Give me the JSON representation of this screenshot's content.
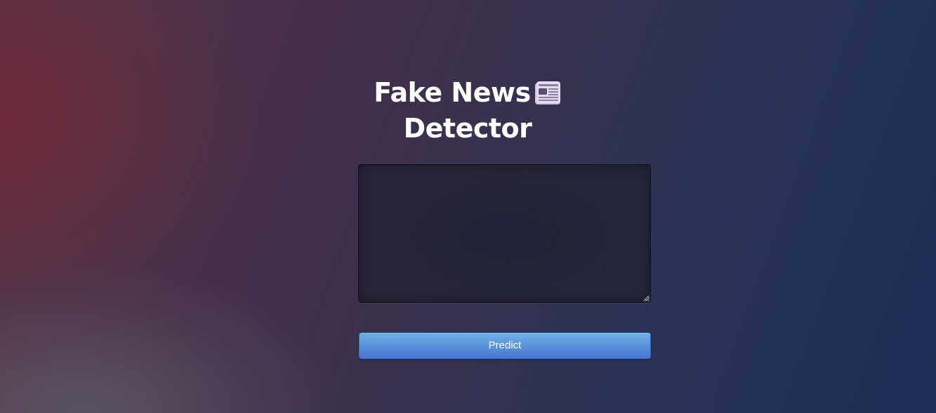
{
  "header": {
    "title_line1": "Fake News",
    "title_line2": "Detector",
    "title_icon": "newspaper-icon"
  },
  "form": {
    "textarea_value": "",
    "textarea_placeholder": "",
    "predict_label": "Predict"
  },
  "colors": {
    "title_text": "#ffffff",
    "button_top": "#6eb1e3",
    "button_bottom": "#4a74cf",
    "bg_left": "#5a3346",
    "bg_right": "#1c2d55"
  }
}
